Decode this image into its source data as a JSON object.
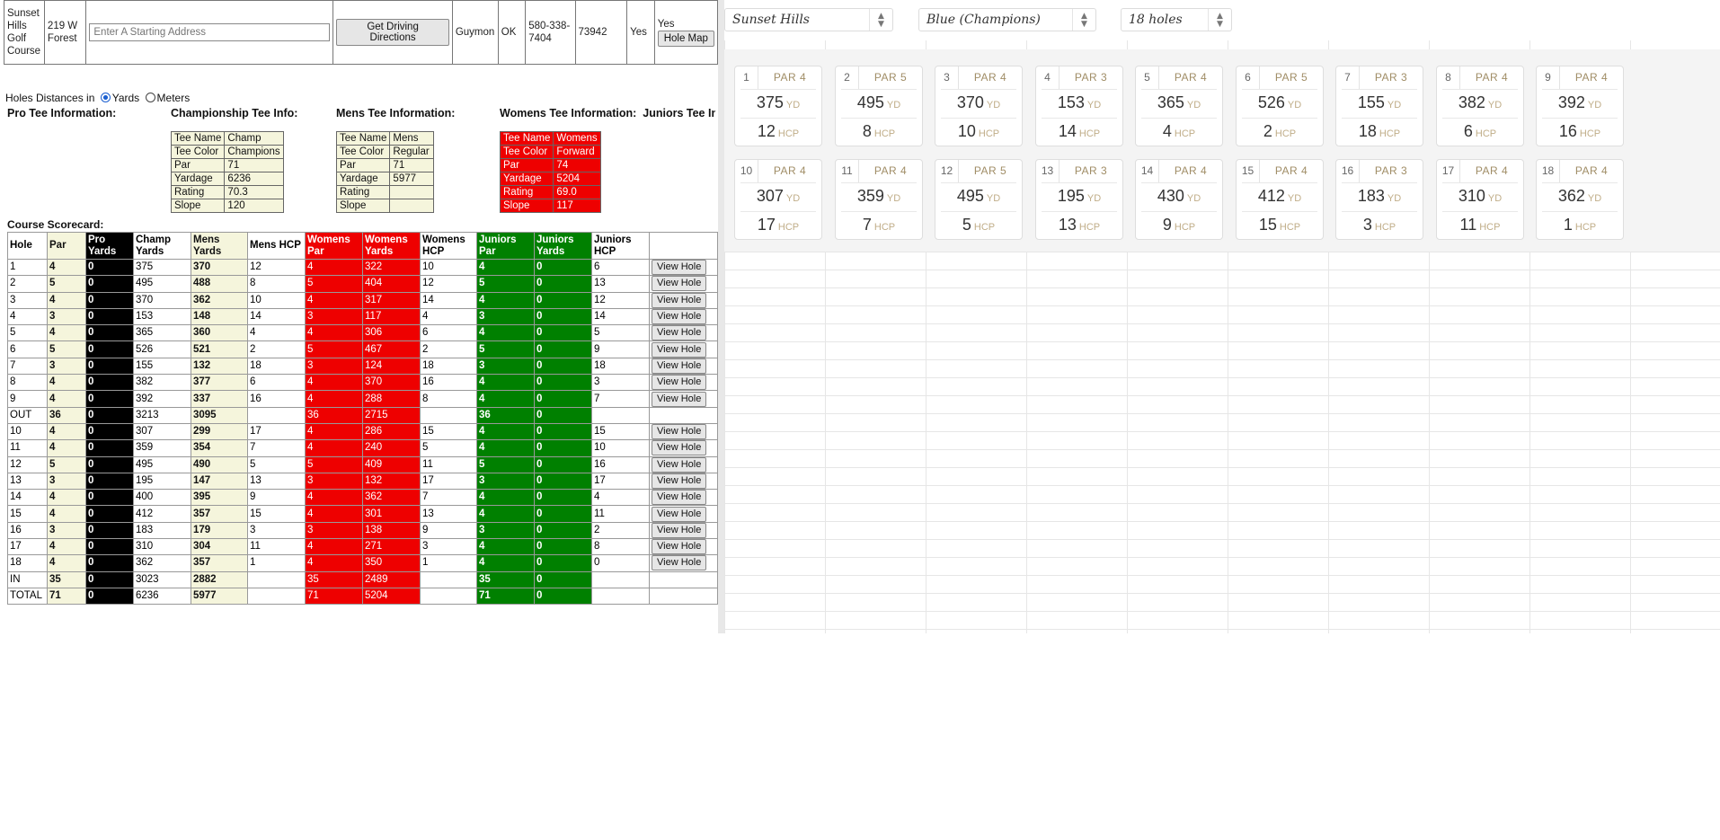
{
  "course_info": {
    "name": "Sunset Hills Golf Course",
    "address": "219 W Forest",
    "start_placeholder": "Enter A Starting Address",
    "directions_label": "Get Driving Directions",
    "city": "Guymon",
    "state": "OK",
    "phone": "580-338-7404",
    "zip": "73942",
    "flag1": "Yes",
    "flag2": "Yes",
    "hole_map_label": "Hole Map"
  },
  "units": {
    "prefix": "Holes Distances in",
    "yards": "Yards",
    "meters": "Meters",
    "selected": "Yards"
  },
  "tee_headers": {
    "pro": "Pro Tee Information:",
    "champ": "Championship Tee Info:",
    "mens": "Mens Tee Information:",
    "womens": "Womens Tee Information:",
    "juniors": "Juniors Tee Information:"
  },
  "tee_boxes": {
    "champ": [
      [
        "Tee Name",
        "Champ"
      ],
      [
        "Tee Color",
        "Champions"
      ],
      [
        "Par",
        "71"
      ],
      [
        "Yardage",
        "6236"
      ],
      [
        "Rating",
        "70.3"
      ],
      [
        "Slope",
        "120"
      ]
    ],
    "mens": [
      [
        "Tee Name",
        "Mens"
      ],
      [
        "Tee Color",
        "Regular"
      ],
      [
        "Par",
        "71"
      ],
      [
        "Yardage",
        "5977"
      ],
      [
        "Rating",
        ""
      ],
      [
        "Slope",
        ""
      ]
    ],
    "womens": [
      [
        "Tee Name",
        "Womens"
      ],
      [
        "Tee Color",
        "Forward"
      ],
      [
        "Par",
        "74"
      ],
      [
        "Yardage",
        "5204"
      ],
      [
        "Rating",
        "69.0"
      ],
      [
        "Slope",
        "117"
      ]
    ]
  },
  "scorecard": {
    "title": "Course Scorecard:",
    "headers": [
      "Hole",
      "Par",
      "Pro Yards",
      "Champ Yards",
      "Mens Yards",
      "Mens HCP",
      "Womens Par",
      "Womens Yards",
      "Womens HCP",
      "Juniors Par",
      "Juniors Yards",
      "Juniors HCP",
      ""
    ],
    "view_label": "View Hole",
    "rows": [
      [
        "1",
        "4",
        "0",
        "375",
        "370",
        "12",
        "4",
        "322",
        "10",
        "4",
        "0",
        "6",
        true
      ],
      [
        "2",
        "5",
        "0",
        "495",
        "488",
        "8",
        "5",
        "404",
        "12",
        "5",
        "0",
        "13",
        true
      ],
      [
        "3",
        "4",
        "0",
        "370",
        "362",
        "10",
        "4",
        "317",
        "14",
        "4",
        "0",
        "12",
        true
      ],
      [
        "4",
        "3",
        "0",
        "153",
        "148",
        "14",
        "3",
        "117",
        "4",
        "3",
        "0",
        "14",
        true
      ],
      [
        "5",
        "4",
        "0",
        "365",
        "360",
        "4",
        "4",
        "306",
        "6",
        "4",
        "0",
        "5",
        true
      ],
      [
        "6",
        "5",
        "0",
        "526",
        "521",
        "2",
        "5",
        "467",
        "2",
        "5",
        "0",
        "9",
        true
      ],
      [
        "7",
        "3",
        "0",
        "155",
        "132",
        "18",
        "3",
        "124",
        "18",
        "3",
        "0",
        "18",
        true
      ],
      [
        "8",
        "4",
        "0",
        "382",
        "377",
        "6",
        "4",
        "370",
        "16",
        "4",
        "0",
        "3",
        true
      ],
      [
        "9",
        "4",
        "0",
        "392",
        "337",
        "16",
        "4",
        "288",
        "8",
        "4",
        "0",
        "7",
        true
      ],
      [
        "OUT",
        "36",
        "0",
        "3213",
        "3095",
        "",
        "36",
        "2715",
        "",
        "36",
        "0",
        "",
        false
      ],
      [
        "10",
        "4",
        "0",
        "307",
        "299",
        "17",
        "4",
        "286",
        "15",
        "4",
        "0",
        "15",
        true
      ],
      [
        "11",
        "4",
        "0",
        "359",
        "354",
        "7",
        "4",
        "240",
        "5",
        "4",
        "0",
        "10",
        true
      ],
      [
        "12",
        "5",
        "0",
        "495",
        "490",
        "5",
        "5",
        "409",
        "11",
        "5",
        "0",
        "16",
        true
      ],
      [
        "13",
        "3",
        "0",
        "195",
        "147",
        "13",
        "3",
        "132",
        "17",
        "3",
        "0",
        "17",
        true
      ],
      [
        "14",
        "4",
        "0",
        "400",
        "395",
        "9",
        "4",
        "362",
        "7",
        "4",
        "0",
        "4",
        true
      ],
      [
        "15",
        "4",
        "0",
        "412",
        "357",
        "15",
        "4",
        "301",
        "13",
        "4",
        "0",
        "11",
        true
      ],
      [
        "16",
        "3",
        "0",
        "183",
        "179",
        "3",
        "3",
        "138",
        "9",
        "3",
        "0",
        "2",
        true
      ],
      [
        "17",
        "4",
        "0",
        "310",
        "304",
        "11",
        "4",
        "271",
        "3",
        "4",
        "0",
        "8",
        true
      ],
      [
        "18",
        "4",
        "0",
        "362",
        "357",
        "1",
        "4",
        "350",
        "1",
        "4",
        "0",
        "0",
        true
      ],
      [
        "IN",
        "35",
        "0",
        "3023",
        "2882",
        "",
        "35",
        "2489",
        "",
        "35",
        "0",
        "",
        false
      ],
      [
        "TOTAL",
        "71",
        "0",
        "6236",
        "5977",
        "",
        "71",
        "5204",
        "",
        "71",
        "0",
        "",
        false
      ]
    ]
  },
  "app": {
    "course_select": "Sunset Hills",
    "tee_select": "Blue (Champions)",
    "holes_select": "18 holes",
    "par_prefix": "PAR",
    "yd_unit": "YD",
    "hcp_unit": "HCP",
    "holes": [
      {
        "num": "1",
        "par": "4",
        "yd": "375",
        "hcp": "12"
      },
      {
        "num": "2",
        "par": "5",
        "yd": "495",
        "hcp": "8"
      },
      {
        "num": "3",
        "par": "4",
        "yd": "370",
        "hcp": "10"
      },
      {
        "num": "4",
        "par": "3",
        "yd": "153",
        "hcp": "14"
      },
      {
        "num": "5",
        "par": "4",
        "yd": "365",
        "hcp": "4"
      },
      {
        "num": "6",
        "par": "5",
        "yd": "526",
        "hcp": "2"
      },
      {
        "num": "7",
        "par": "3",
        "yd": "155",
        "hcp": "18"
      },
      {
        "num": "8",
        "par": "4",
        "yd": "382",
        "hcp": "6"
      },
      {
        "num": "9",
        "par": "4",
        "yd": "392",
        "hcp": "16"
      },
      {
        "num": "10",
        "par": "4",
        "yd": "307",
        "hcp": "17"
      },
      {
        "num": "11",
        "par": "4",
        "yd": "359",
        "hcp": "7"
      },
      {
        "num": "12",
        "par": "5",
        "yd": "495",
        "hcp": "5"
      },
      {
        "num": "13",
        "par": "3",
        "yd": "195",
        "hcp": "13"
      },
      {
        "num": "14",
        "par": "4",
        "yd": "430",
        "hcp": "9"
      },
      {
        "num": "15",
        "par": "4",
        "yd": "412",
        "hcp": "15"
      },
      {
        "num": "16",
        "par": "3",
        "yd": "183",
        "hcp": "3"
      },
      {
        "num": "17",
        "par": "4",
        "yd": "310",
        "hcp": "11"
      },
      {
        "num": "18",
        "par": "4",
        "yd": "362",
        "hcp": "1"
      }
    ]
  }
}
